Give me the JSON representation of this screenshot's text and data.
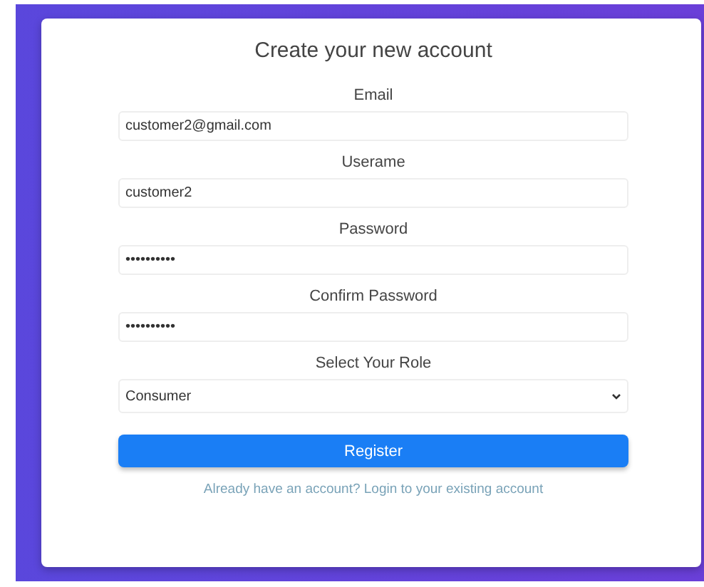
{
  "title": "Create your new account",
  "fields": [
    {
      "kind": "input",
      "label": "Email",
      "value": "customer2@gmail.com"
    },
    {
      "kind": "input",
      "label": "Userame",
      "value": "customer2"
    },
    {
      "kind": "input",
      "label": "Password",
      "value": "••••••••••"
    },
    {
      "kind": "input",
      "label": "Confirm Password",
      "value": "••••••••••"
    },
    {
      "kind": "select",
      "label": "Select Your Role",
      "value": "Consumer"
    }
  ],
  "button": "Register",
  "link": "Already have an account? Login to your existing account"
}
